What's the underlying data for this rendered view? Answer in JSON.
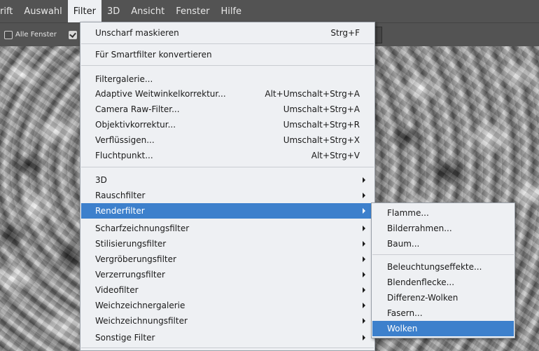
{
  "menubar": {
    "items": [
      {
        "label": "rift"
      },
      {
        "label": "Auswahl"
      },
      {
        "label": "Filter"
      },
      {
        "label": "3D"
      },
      {
        "label": "Ansicht"
      },
      {
        "label": "Fenster"
      },
      {
        "label": "Hilfe"
      }
    ],
    "active": "Filter"
  },
  "options_bar": {
    "all_windows_label": "Alle Fenster",
    "all_windows_checked": false,
    "second_checkbox_checked": true
  },
  "filter_menu": {
    "items": [
      {
        "label": "Unscharf maskieren",
        "shortcut": "Strg+F"
      },
      {
        "label": "Für Smartfilter konvertieren",
        "shortcut": ""
      },
      {
        "label": "Filtergalerie...",
        "shortcut": ""
      },
      {
        "label": "Adaptive Weitwinkelkorrektur...",
        "shortcut": "Alt+Umschalt+Strg+A"
      },
      {
        "label": "Camera Raw-Filter...",
        "shortcut": "Umschalt+Strg+A"
      },
      {
        "label": "Objektivkorrektur...",
        "shortcut": "Umschalt+Strg+R"
      },
      {
        "label": "Verflüssigen...",
        "shortcut": "Umschalt+Strg+X"
      },
      {
        "label": "Fluchtpunkt...",
        "shortcut": "Alt+Strg+V"
      },
      {
        "label": "3D",
        "submenu": true
      },
      {
        "label": "Rauschfilter",
        "submenu": true
      },
      {
        "label": "Renderfilter",
        "submenu": true,
        "highlighted": true
      },
      {
        "label": "Scharfzeichnungsfilter",
        "submenu": true
      },
      {
        "label": "Stilisierungsfilter",
        "submenu": true
      },
      {
        "label": "Vergröberungsfilter",
        "submenu": true
      },
      {
        "label": "Verzerrungsfilter",
        "submenu": true
      },
      {
        "label": "Videofilter",
        "submenu": true
      },
      {
        "label": "Weichzeichnergalerie",
        "submenu": true
      },
      {
        "label": "Weichzeichnungsfilter",
        "submenu": true
      },
      {
        "label": "Sonstige Filter",
        "submenu": true
      }
    ]
  },
  "render_submenu": {
    "items": [
      {
        "label": "Flamme..."
      },
      {
        "label": "Bilderrahmen..."
      },
      {
        "label": "Baum..."
      },
      {
        "label": "Beleuchtungseffekte..."
      },
      {
        "label": "Blendenflecke..."
      },
      {
        "label": "Differenz-Wolken"
      },
      {
        "label": "Fasern..."
      },
      {
        "label": "Wolken",
        "highlighted": true
      }
    ]
  },
  "colors": {
    "menubar_bg": "#535353",
    "menu_bg": "#eef0f3",
    "highlight": "#3d80cc"
  }
}
